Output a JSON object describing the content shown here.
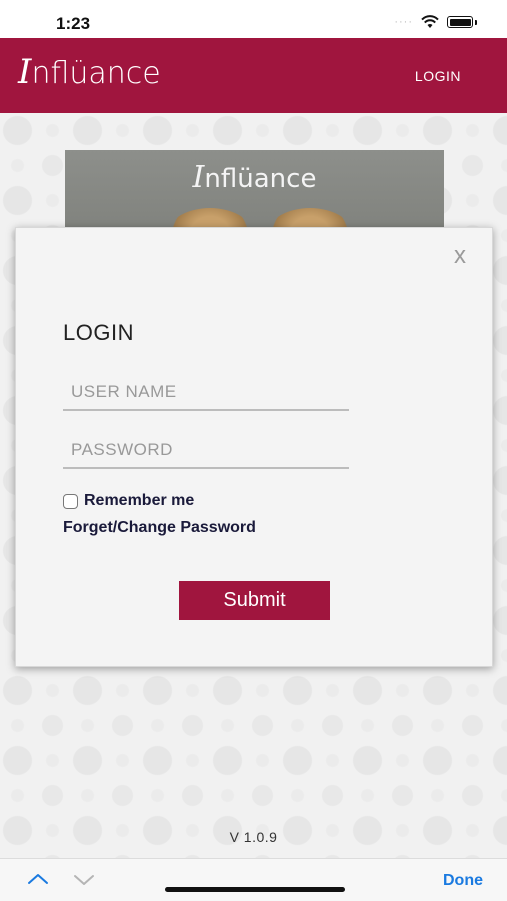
{
  "status_bar": {
    "time": "1:23",
    "signal": "····"
  },
  "header": {
    "brand_name": "nflüance",
    "brand_initial": "I",
    "login_label": "LOGIN",
    "accent_color": "#a0153e"
  },
  "hero": {
    "brand_name": "nflüance",
    "brand_initial": "I"
  },
  "login_modal": {
    "close_label": "x",
    "title": "LOGIN",
    "username_placeholder": "USER NAME",
    "password_placeholder": "PASSWORD",
    "remember_label": "Remember me",
    "forgot_label": "Forget/Change Password",
    "submit_label": "Submit"
  },
  "footer": {
    "version": "V 1.0.9"
  },
  "accessory_bar": {
    "done_label": "Done"
  }
}
